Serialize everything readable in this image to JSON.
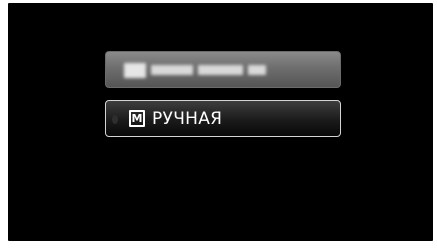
{
  "menu": {
    "items": [
      {
        "label": "",
        "state": "blurred",
        "blurred": true
      },
      {
        "icon": "manual-mode-icon",
        "icon_text": "M",
        "label": "РУЧНАЯ",
        "state": "selected"
      }
    ]
  },
  "colors": {
    "screen_background": "#000000",
    "selected_border": "#d4d4d4",
    "blurred_item_fill": "#7a7a7a",
    "text": "#ffffff"
  }
}
